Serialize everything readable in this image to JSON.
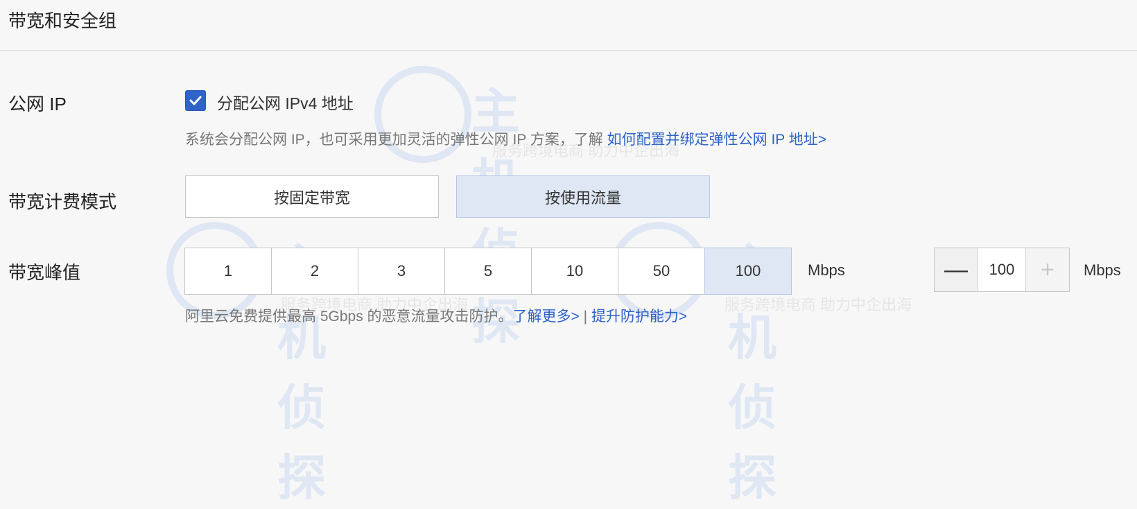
{
  "section": {
    "title": "带宽和安全组"
  },
  "public_ip": {
    "label": "公网 IP",
    "checkbox_label": "分配公网 IPv4 地址",
    "checked": true,
    "hint_text": "系统会分配公网 IP，也可采用更加灵活的弹性公网 IP 方案，了解 ",
    "hint_link": "如何配置并绑定弹性公网 IP 地址>"
  },
  "billing": {
    "label": "带宽计费模式",
    "options": [
      "按固定带宽",
      "按使用流量"
    ],
    "selected": "按使用流量"
  },
  "bandwidth": {
    "label": "带宽峰值",
    "options": [
      "1",
      "2",
      "3",
      "5",
      "10",
      "50",
      "100"
    ],
    "selected": "100",
    "unit": "Mbps",
    "stepper_value": "100",
    "stepper_unit": "Mbps",
    "hint_text": "阿里云免费提供最高 5Gbps 的恶意流量攻击防护。",
    "hint_link1": "了解更多>",
    "separator": " | ",
    "hint_link2": "提升防护能力>"
  },
  "watermark": {
    "logo": "主机侦探",
    "slogan": "服务跨境电商 助力中企出海"
  },
  "colors": {
    "accent": "#2f63c8",
    "selected_bg": "#dfe7f4"
  }
}
